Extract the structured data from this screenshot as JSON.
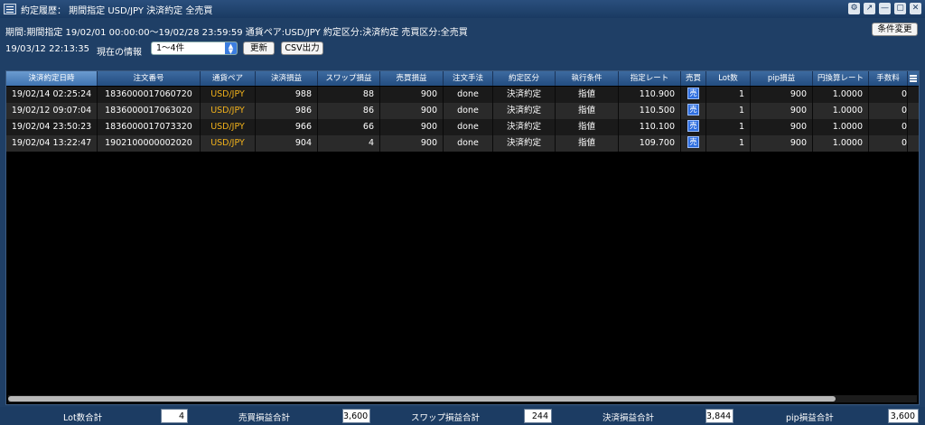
{
  "window": {
    "title": "約定履歴： 期間指定 USD/JPY 決済約定 全売買",
    "controls": [
      "⚙",
      "↗",
      "—",
      "▢",
      "✕"
    ]
  },
  "info": {
    "summary": "期間:期間指定 19/02/01 00:00:00〜19/02/28 23:59:59 通貨ペア:USD/JPY 約定区分:決済約定 売買区分:全売買",
    "datetime": "19/03/12 22:13:35",
    "current_label": "現在の情報",
    "range_select": "1〜4件",
    "condition_button": "条件変更",
    "refresh_button": "更新",
    "csv_button": "CSV出力"
  },
  "table": {
    "columns": [
      "決済約定日時",
      "注文番号",
      "通貨ペア",
      "決済損益",
      "スワップ損益",
      "売買損益",
      "注文手法",
      "約定区分",
      "執行条件",
      "指定レート",
      "売買",
      "Lot数",
      "pip損益",
      "円換算レート",
      "手数料"
    ],
    "rows": [
      [
        "19/02/14 02:25:24",
        "1836000017060720",
        "USD/JPY",
        "988",
        "88",
        "900",
        "done",
        "決済約定",
        "指値",
        "110.900",
        "売",
        "1",
        "900",
        "1.0000",
        "0"
      ],
      [
        "19/02/12 09:07:04",
        "1836000017063020",
        "USD/JPY",
        "986",
        "86",
        "900",
        "done",
        "決済約定",
        "指値",
        "110.500",
        "売",
        "1",
        "900",
        "1.0000",
        "0"
      ],
      [
        "19/02/04 23:50:23",
        "1836000017073320",
        "USD/JPY",
        "966",
        "66",
        "900",
        "done",
        "決済約定",
        "指値",
        "110.100",
        "売",
        "1",
        "900",
        "1.0000",
        "0"
      ],
      [
        "19/02/04 13:22:47",
        "1902100000002020",
        "USD/JPY",
        "904",
        "4",
        "900",
        "done",
        "決済約定",
        "指値",
        "109.700",
        "売",
        "1",
        "900",
        "1.0000",
        "0"
      ]
    ]
  },
  "footer": {
    "lot_label": "Lot数合計",
    "lot_value": "4",
    "trade_label": "売買損益合計",
    "trade_value": "3,600",
    "swap_label": "スワップ損益合計",
    "swap_value": "244",
    "settle_label": "決済損益合計",
    "settle_value": "3,844",
    "pip_label": "pip損益合計",
    "pip_value": "3,600"
  },
  "colors": {
    "titlebar": "#1f3f66",
    "currency_pair": "#f2b21b",
    "sell_badge": "#2f6fe0",
    "grid_bg": "#000000"
  }
}
